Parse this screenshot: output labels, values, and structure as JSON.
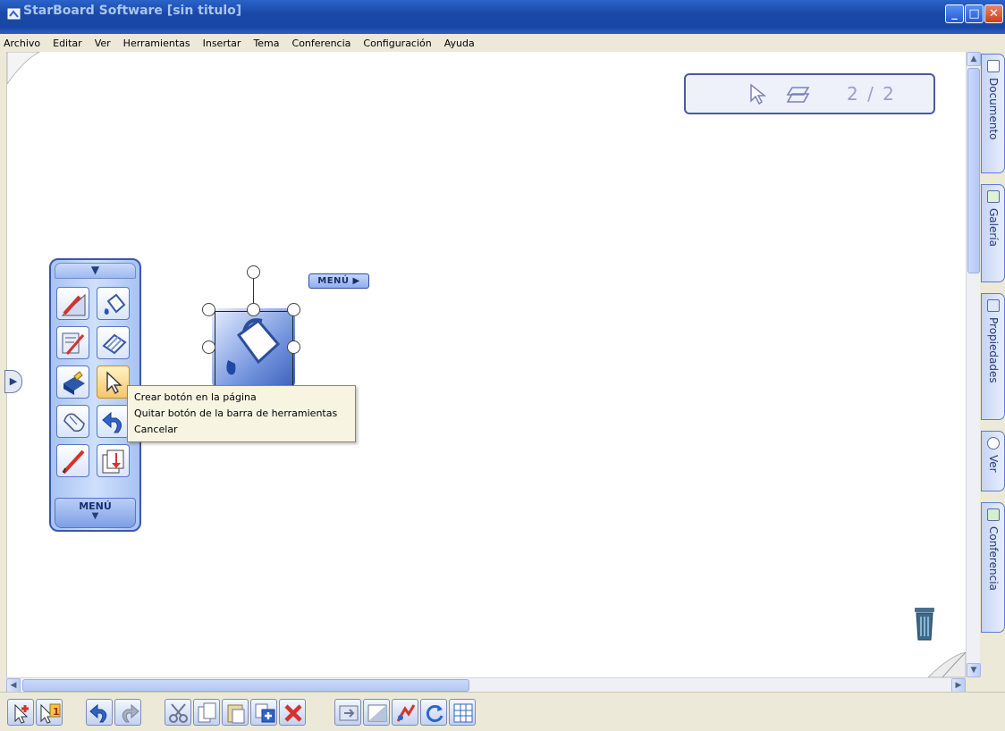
{
  "window": {
    "title": "StarBoard Software [sin titulo]",
    "controls": {
      "minimize": "_",
      "maximize": "□",
      "close": "✕"
    }
  },
  "menubar": {
    "items": [
      "Archivo",
      "Editar",
      "Ver",
      "Herramientas",
      "Insertar",
      "Tema",
      "Conferencia",
      "Configuración",
      "Ayuda"
    ]
  },
  "page_indicator": {
    "counter": "2 / 2",
    "icons": [
      "cursor-icon",
      "layers-icon"
    ]
  },
  "side_tabs": [
    {
      "label": "Documento",
      "icon": "document-icon"
    },
    {
      "label": "Galería",
      "icon": "gallery-icon"
    },
    {
      "label": "Propiedades",
      "icon": "properties-icon"
    },
    {
      "label": "Ver",
      "icon": "view-icon"
    },
    {
      "label": "Conferencia",
      "icon": "conference-icon"
    }
  ],
  "floating_toolbar": {
    "menu_label": "MENÚ",
    "tools": [
      "pen-ruler-icon",
      "paint-bucket-icon",
      "pen-tools-icon",
      "eraser-icon",
      "tools-box-icon",
      "pointer-icon",
      "mouse-icon",
      "undo-icon",
      "pen-icon",
      "insert-page-icon"
    ],
    "selected_tool": "pointer-icon"
  },
  "canvas": {
    "menu_badge": "MENÚ",
    "selected_object": "paint-bucket-icon"
  },
  "context_menu": {
    "items": [
      "Crear botón en la página",
      "Quitar botón de la barra de herramientas",
      "Cancelar"
    ]
  },
  "bottom_toolbar": {
    "buttons": [
      "new-page-icon",
      "page-1-icon",
      "undo-icon",
      "redo-icon",
      "cut-icon",
      "copy-icon",
      "paste-icon",
      "duplicate-icon",
      "delete-icon",
      "screen-capture-icon",
      "hide-icon",
      "share-icon",
      "refresh-icon",
      "grid-icon"
    ]
  },
  "colors": {
    "titlebar": "#1b48a8",
    "tab_border": "#5b7dd4",
    "context_menu_bg": "#f7f4e2"
  }
}
